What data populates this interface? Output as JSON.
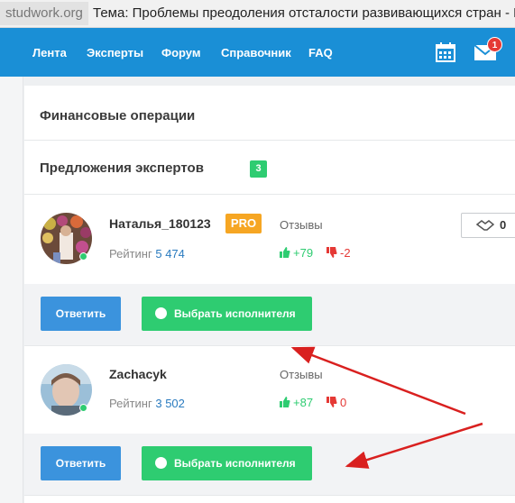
{
  "browser": {
    "site_chip": "studwork.org",
    "tab_title": "Тема: Проблемы преодоления отсталости развивающихся стран - К"
  },
  "nav": {
    "items": [
      {
        "label": "Лента"
      },
      {
        "label": "Эксперты"
      },
      {
        "label": "Форум"
      },
      {
        "label": "Справочник"
      },
      {
        "label": "FAQ"
      }
    ],
    "icons": [
      "calendar-icon",
      "mail-icon"
    ],
    "mail_badge": "1"
  },
  "panel": {
    "finance_title": "Финансовые операции",
    "offers_title": "Предложения экспертов",
    "offers_count": "3"
  },
  "experts": [
    {
      "name": "Наталья_180123",
      "pro_label": "PRO",
      "rating_label": "Рейтинг",
      "rating": "5 474",
      "reviews_label": "Отзывы",
      "positive": "+79",
      "negative": "-2",
      "deal_count": "0"
    },
    {
      "name": "Zachacyk",
      "rating_label": "Рейтинг",
      "rating": "3 502",
      "reviews_label": "Отзывы",
      "positive": "+87",
      "negative": "0"
    }
  ],
  "buttons": {
    "reply": "Ответить",
    "choose": "Выбрать исполнителя"
  },
  "colors": {
    "nav_blue": "#1a8fd6",
    "green": "#2ecc71",
    "pro_orange": "#f6a623",
    "red": "#e53935",
    "arrow": "#d9201f"
  }
}
